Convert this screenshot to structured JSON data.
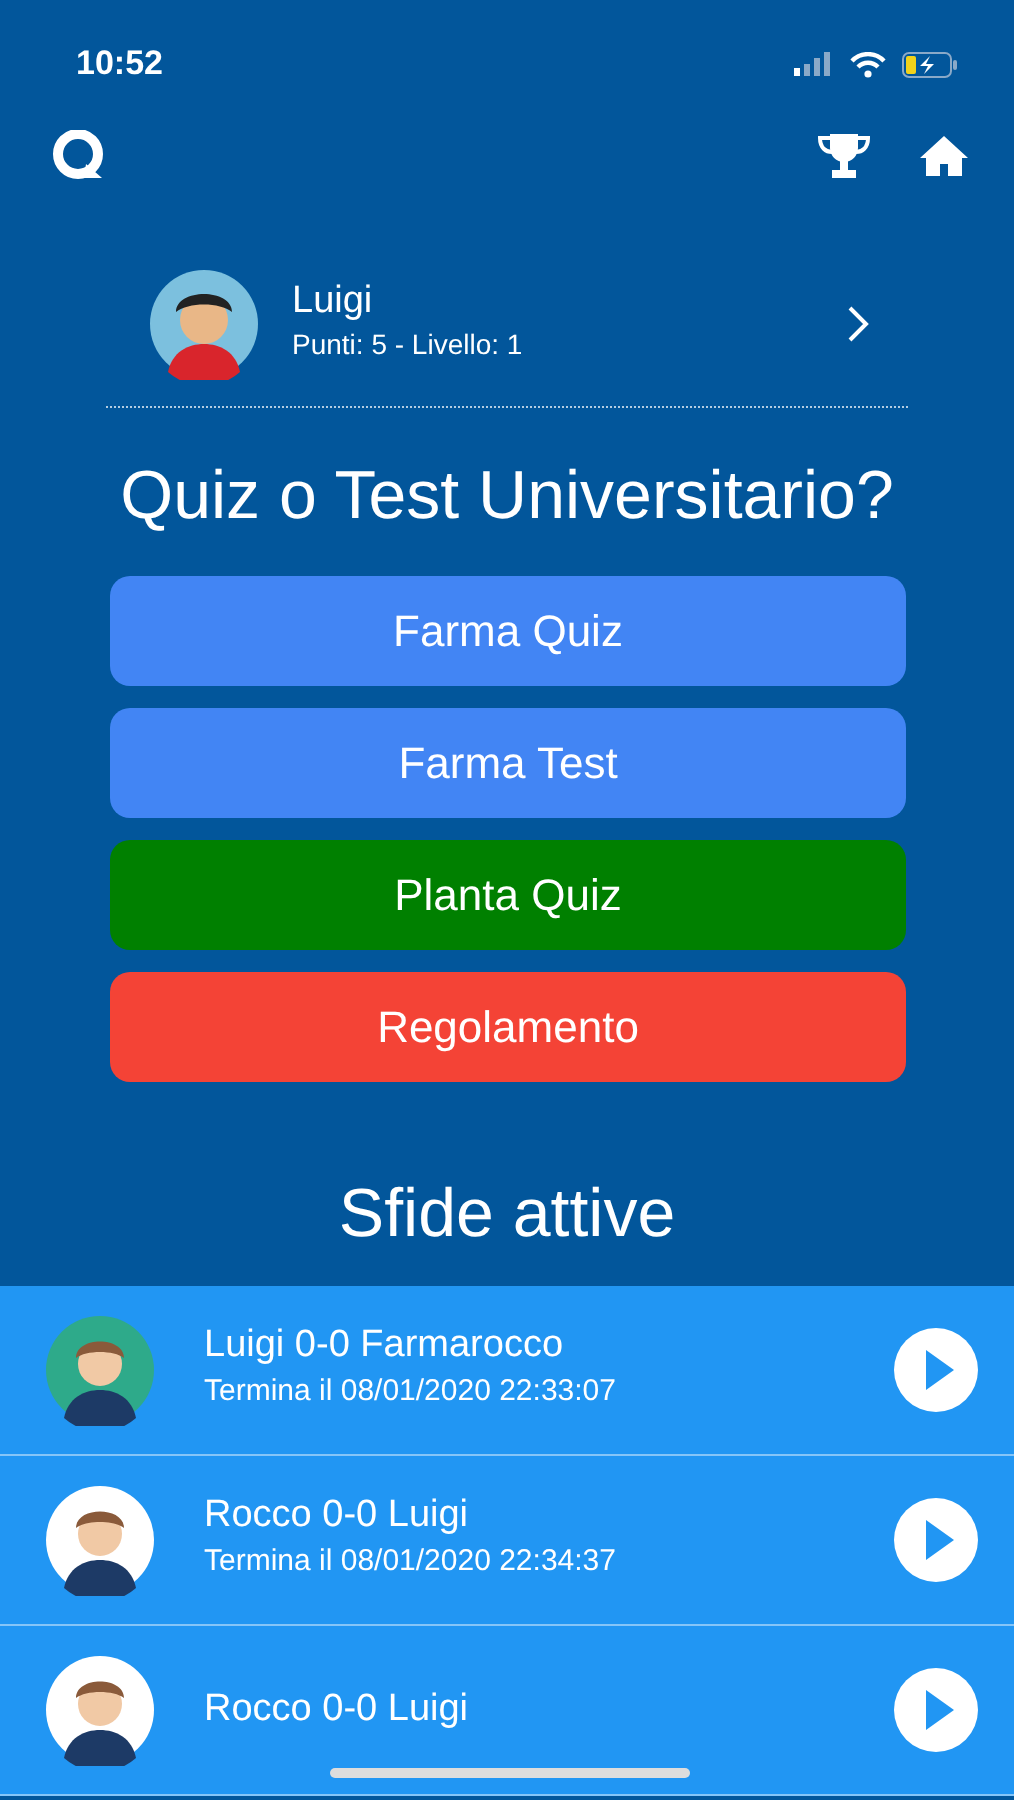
{
  "status_bar": {
    "time": "10:52"
  },
  "profile": {
    "name": "Luigi",
    "stats": "Punti: 5 - Livello: 1"
  },
  "heading": "Quiz o Test Universitario?",
  "buttons": [
    {
      "label": "Farma Quiz",
      "color": "#4285f4"
    },
    {
      "label": "Farma Test",
      "color": "#4285f4"
    },
    {
      "label": "Planta Quiz",
      "color": "#008000"
    },
    {
      "label": "Regolamento",
      "color": "#f44336"
    }
  ],
  "challenges_title": "Sfide attive",
  "challenges": [
    {
      "title": "Luigi 0-0 Farmarocco",
      "ends": "Termina il 08/01/2020 22:33:07",
      "color": "#2eaa8a"
    },
    {
      "title": "Rocco 0-0 Luigi",
      "ends": "Termina il 08/01/2020 22:34:37",
      "color": "#ffffff"
    },
    {
      "title": "Rocco 0-0 Luigi",
      "color": "#ffffff"
    }
  ]
}
